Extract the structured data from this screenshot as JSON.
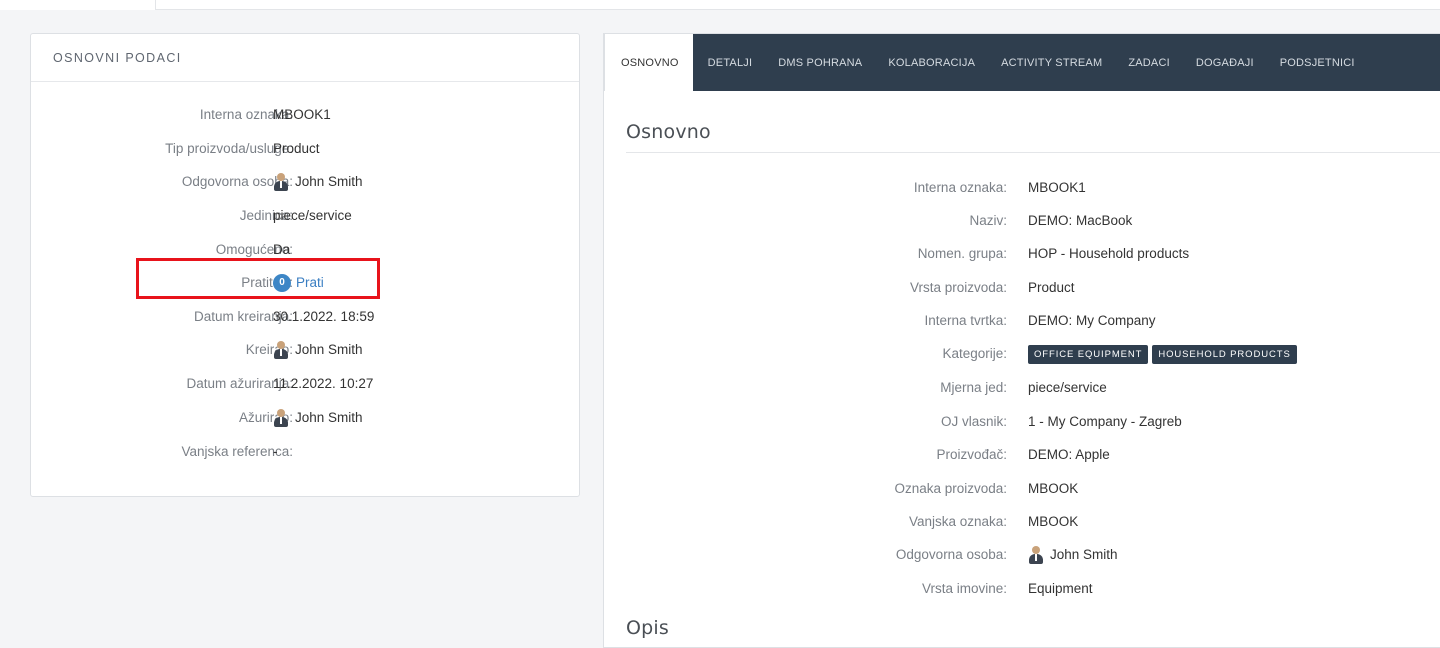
{
  "left_card": {
    "title": "OSNOVNI PODACI",
    "fields": [
      {
        "label": "Interna oznaka:",
        "value": "MBOOK1"
      },
      {
        "label": "Tip proizvoda/usluge:",
        "value": "Product"
      },
      {
        "label": "Odgovorna osoba:",
        "value": "John Smith",
        "type": "user"
      },
      {
        "label": "Jedinica:",
        "value": "piece/service"
      },
      {
        "label": "Omogućeno:",
        "value": "Da"
      },
      {
        "label": "Pratitelji:",
        "value": "Prati",
        "count": "0",
        "type": "follow"
      },
      {
        "label": "Datum kreiranja:",
        "value": "30.1.2022. 18:59"
      },
      {
        "label": "Kreirao:",
        "value": "John Smith",
        "type": "user"
      },
      {
        "label": "Datum ažuriranja:",
        "value": "11.2.2022. 10:27"
      },
      {
        "label": "Ažurirao:",
        "value": "John Smith",
        "type": "user"
      },
      {
        "label": "Vanjska referenca:",
        "value": "-"
      }
    ]
  },
  "tabs": [
    {
      "label": "OSNOVNO",
      "active": true
    },
    {
      "label": "DETALJI"
    },
    {
      "label": "DMS POHRANA"
    },
    {
      "label": "KOLABORACIJA"
    },
    {
      "label": "ACTIVITY STREAM"
    },
    {
      "label": "ZADACI"
    },
    {
      "label": "DOGAĐAJI"
    },
    {
      "label": "PODSJETNICI"
    }
  ],
  "main": {
    "section_title": "Osnovno",
    "fields": [
      {
        "label": "Interna oznaka:",
        "value": "MBOOK1"
      },
      {
        "label": "Naziv:",
        "value": "DEMO: MacBook"
      },
      {
        "label": "Nomen. grupa:",
        "value": "HOP - Household products"
      },
      {
        "label": "Vrsta proizvoda:",
        "value": "Product"
      },
      {
        "label": "Interna tvrtka:",
        "value": "DEMO: My Company",
        "type": "link"
      },
      {
        "label": "Kategorije:",
        "tags": [
          "OFFICE EQUIPMENT",
          "HOUSEHOLD PRODUCTS"
        ],
        "type": "tags"
      },
      {
        "label": "Mjerna jed:",
        "value": "piece/service"
      },
      {
        "label": "OJ vlasnik:",
        "value": "1 - My Company - Zagreb"
      },
      {
        "label": "Proizvođač:",
        "value": "DEMO: Apple"
      },
      {
        "label": "Oznaka proizvoda:",
        "value": "MBOOK"
      },
      {
        "label": "Vanjska oznaka:",
        "value": "MBOOK"
      },
      {
        "label": "Odgovorna osoba:",
        "value": "John Smith",
        "type": "user"
      },
      {
        "label": "Vrsta imovine:",
        "value": "Equipment"
      }
    ],
    "section2_title": "Opis"
  },
  "colors": {
    "tabbar": "#2f3e4e",
    "link": "#3a7ec2",
    "highlight": "#e8131b",
    "badge": "#3d86c6"
  }
}
